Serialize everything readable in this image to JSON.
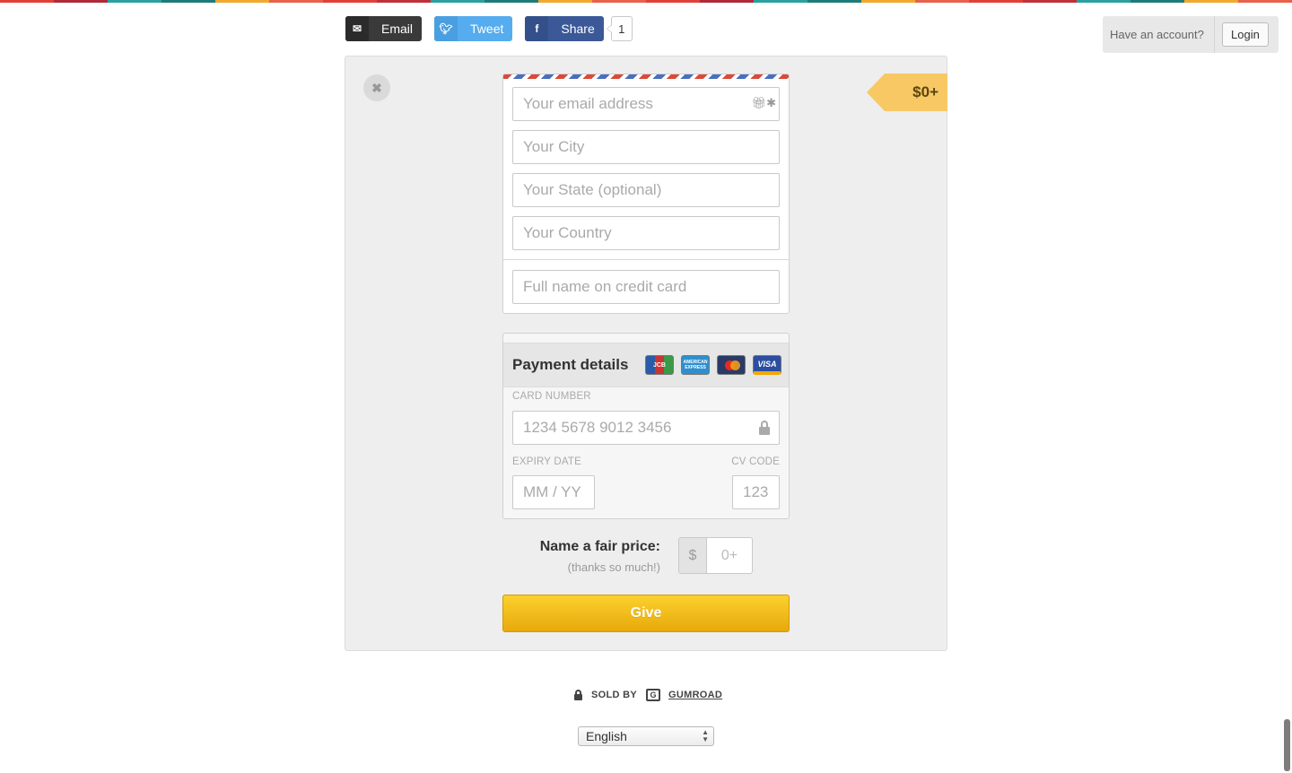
{
  "colors": {
    "rainbow": [
      "#e0403a",
      "#b02a3a",
      "#2aa19f",
      "#1f7a7a",
      "#f0a830",
      "#e8614a",
      "#e0403a",
      "#c0303a",
      "#2aa19f",
      "#1f7a7a",
      "#f0a830",
      "#e8614a",
      "#e0403a",
      "#b02a3a",
      "#2aa19f",
      "#1f7a7a",
      "#f0a830",
      "#e8614a",
      "#e0403a",
      "#c0303a",
      "#2aa19f",
      "#1f7a7a",
      "#f0a830",
      "#e8614a"
    ],
    "give_button": "#f5c11c",
    "price_tag": "#f8c865"
  },
  "share": {
    "email_label": "Email",
    "email_icon": "envelope-icon",
    "tweet_label": "Tweet",
    "tweet_icon": "twitter-icon",
    "share_label": "Share",
    "share_icon": "facebook-icon",
    "count": "1"
  },
  "account": {
    "question": "Have an account?",
    "login_label": "Login"
  },
  "product": {
    "price_tag": "$0+"
  },
  "form": {
    "email_placeholder": "Your email address",
    "city_placeholder": "Your City",
    "state_placeholder": "Your State (optional)",
    "country_placeholder": "Your Country",
    "name_placeholder": "Full name on credit card"
  },
  "payment": {
    "title": "Payment details",
    "cards": [
      "JCB",
      "AMERICAN EXPRESS",
      "MasterCard",
      "VISA"
    ],
    "card_number_label": "CARD NUMBER",
    "card_number_placeholder": "1234 5678 9012 3456",
    "expiry_label": "EXPIRY DATE",
    "expiry_placeholder": "MM / YY",
    "cv_label": "CV CODE",
    "cv_placeholder": "123"
  },
  "price": {
    "title": "Name a fair price:",
    "subtitle": "(thanks so much!)",
    "currency": "$",
    "placeholder": "0+"
  },
  "give_label": "Give",
  "footer": {
    "sold_by": "SOLD BY",
    "seller": "GUMROAD",
    "language": "English"
  }
}
